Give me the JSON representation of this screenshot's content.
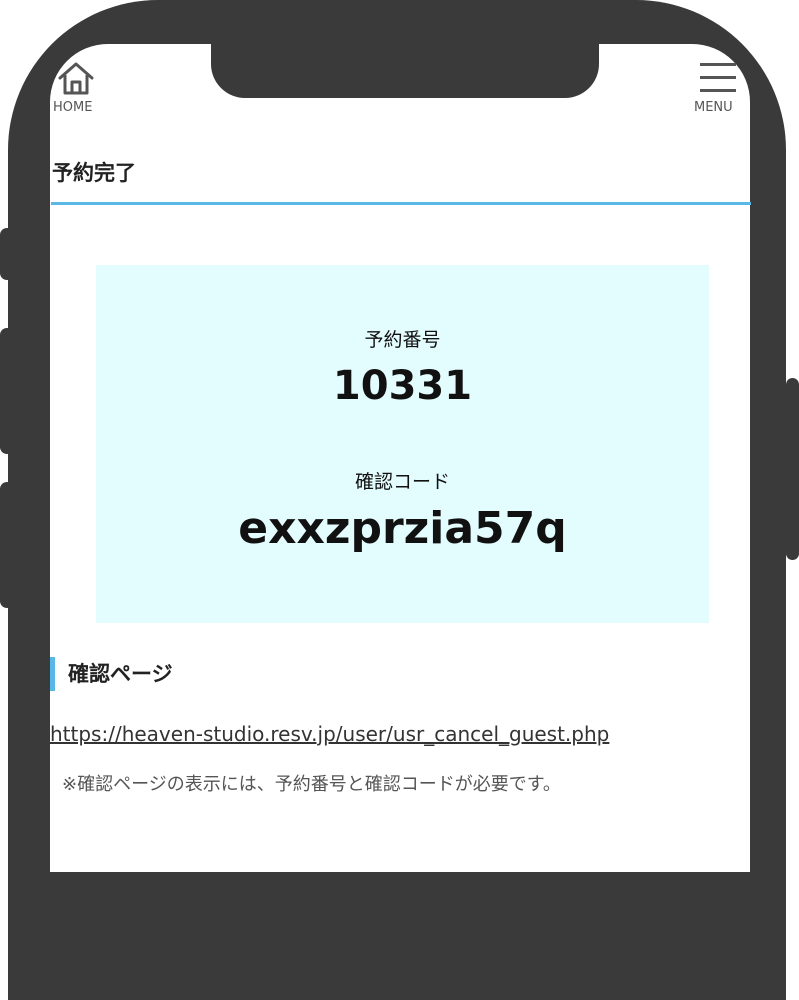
{
  "header": {
    "home_label": "HOME",
    "menu_label": "MENU"
  },
  "page": {
    "title": "予約完了"
  },
  "reservation": {
    "number_label": "予約番号",
    "number": "10331",
    "code_label": "確認コード",
    "code": "exxzprzia57q"
  },
  "confirm": {
    "heading": "確認ページ",
    "link": "https://heaven-studio.resv.jp/user/usr_cancel_guest.php",
    "note": "※確認ページの表示には、予約番号と確認コードが必要です。"
  },
  "colors": {
    "accent": "#5ab8e6",
    "box_bg": "#e3fcfd",
    "frame": "#3a3a3a"
  }
}
